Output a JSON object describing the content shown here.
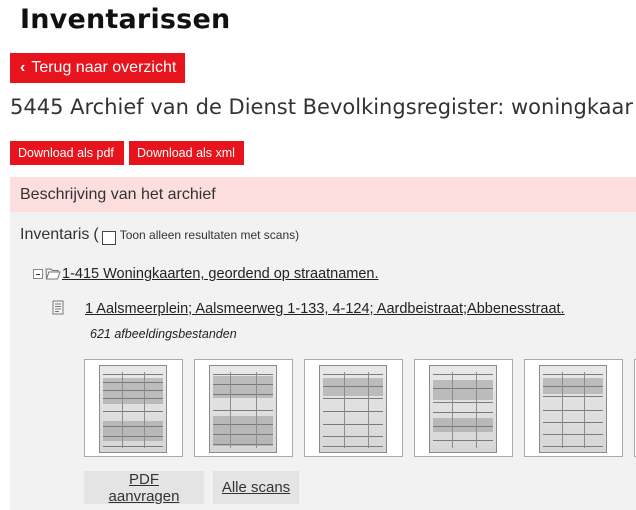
{
  "page": {
    "heading": "Inventarissen",
    "back_label": "Terug naar overzicht",
    "archive_title": "5445 Archief van de Dienst Bevolkingsregister: woningkaar"
  },
  "downloads": {
    "pdf_label": "Download als pdf",
    "xml_label": "Download als xml"
  },
  "panel": {
    "header": "Beschrijving van het archief",
    "inventaris_label": "Inventaris",
    "paren_open": "(",
    "scan_filter_label": "Toon alleen resultaten met scans)"
  },
  "tree": {
    "node_label": "1-415 Woningkaarten, geordend op straatnamen.",
    "item_label": "1 Aalsmeerplein; Aalsmeerweg 1-133, 4-124; Aardbeistraat;Abbenesstraat.",
    "image_count": "621 afbeeldingsbestanden"
  },
  "thumbnails": [
    {
      "name": "scan-1"
    },
    {
      "name": "scan-2"
    },
    {
      "name": "scan-3"
    },
    {
      "name": "scan-4"
    },
    {
      "name": "scan-5"
    }
  ],
  "actions": {
    "pdf_request": "PDF aanvragen",
    "all_scans": "Alle scans"
  },
  "colors": {
    "accent": "#e8141d",
    "panel_header_bg": "#fcdedf",
    "panel_body_bg": "#f2f2f2"
  }
}
